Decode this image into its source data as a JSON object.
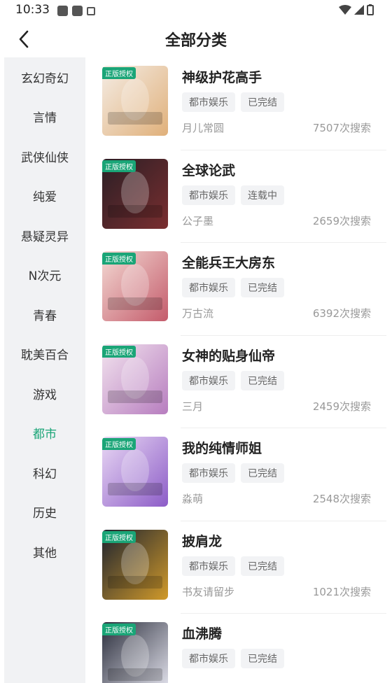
{
  "status": {
    "time": "10:33"
  },
  "header": {
    "title": "全部分类"
  },
  "sidebar": {
    "items": [
      {
        "label": "玄幻奇幻",
        "active": false
      },
      {
        "label": "言情",
        "active": false
      },
      {
        "label": "武侠仙侠",
        "active": false
      },
      {
        "label": "纯爱",
        "active": false
      },
      {
        "label": "悬疑灵异",
        "active": false
      },
      {
        "label": "N次元",
        "active": false
      },
      {
        "label": "青春",
        "active": false
      },
      {
        "label": "耽美百合",
        "active": false
      },
      {
        "label": "游戏",
        "active": false
      },
      {
        "label": "都市",
        "active": true
      },
      {
        "label": "科幻",
        "active": false
      },
      {
        "label": "历史",
        "active": false
      },
      {
        "label": "其他",
        "active": false
      }
    ]
  },
  "books": [
    {
      "badge": "正版授权",
      "title": "神级护花高手",
      "tags": [
        "都市娱乐",
        "已完结"
      ],
      "author": "月儿常圆",
      "searches": "7507次搜索",
      "cover_colors": [
        "#f4ece4",
        "#e0b07a"
      ]
    },
    {
      "badge": "正版授权",
      "title": "全球论武",
      "tags": [
        "都市娱乐",
        "连载中"
      ],
      "author": "公子墨",
      "searches": "2659次搜索",
      "cover_colors": [
        "#2a1f25",
        "#7a2e30"
      ]
    },
    {
      "badge": "正版授权",
      "title": "全能兵王大房东",
      "tags": [
        "都市娱乐",
        "已完结"
      ],
      "author": "万古流",
      "searches": "6392次搜索",
      "cover_colors": [
        "#f3d9d3",
        "#c45b6b"
      ]
    },
    {
      "badge": "正版授权",
      "title": "女神的贴身仙帝",
      "tags": [
        "都市娱乐",
        "已完结"
      ],
      "author": "三月",
      "searches": "2459次搜索",
      "cover_colors": [
        "#f2e3ee",
        "#b77dbf"
      ]
    },
    {
      "badge": "正版授权",
      "title": "我的纯情师姐",
      "tags": [
        "都市娱乐",
        "已完结"
      ],
      "author": "淼萌",
      "searches": "2548次搜索",
      "cover_colors": [
        "#e9d8f4",
        "#8c5cc7"
      ]
    },
    {
      "badge": "正版授权",
      "title": "披肩龙",
      "tags": [
        "都市娱乐",
        "已完结"
      ],
      "author": "书友请留步",
      "searches": "1021次搜索",
      "cover_colors": [
        "#1d2330",
        "#d19a2a"
      ]
    },
    {
      "badge": "正版授权",
      "title": "血沸腾",
      "tags": [
        "都市娱乐",
        "已完结"
      ],
      "author": "",
      "searches": "",
      "cover_colors": [
        "#2a2d3b",
        "#e6e6f0"
      ]
    }
  ]
}
